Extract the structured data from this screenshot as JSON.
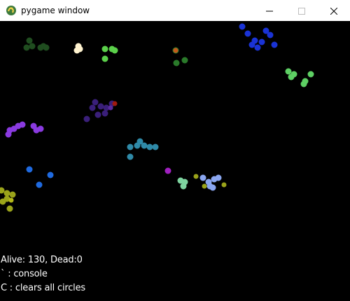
{
  "window": {
    "title": "pygame window",
    "icon": "pygame-snake-icon",
    "controls": [
      "minimize-icon",
      "maximize-icon",
      "close-icon"
    ]
  },
  "hud": {
    "status": "Alive: 130, Dead:0",
    "console_hint": "` : console",
    "clear_hint": "C : clears all circles"
  },
  "game": {
    "background": "#000000",
    "clusters": [
      {
        "name": "dark-green-cluster",
        "color": "#1f4d1f"
      },
      {
        "name": "cream-cluster",
        "color": "#fff3cf"
      },
      {
        "name": "lime-cluster",
        "color": "#5bd04a"
      },
      {
        "name": "orange-green-cluster",
        "color": "#2a7a2a"
      },
      {
        "name": "blue-cluster",
        "color": "#1a33d6"
      },
      {
        "name": "light-green-cluster",
        "color": "#5ed064"
      },
      {
        "name": "indigo-cluster",
        "color": "#3a1f7a"
      },
      {
        "name": "purple-cluster",
        "color": "#8a3ae0"
      },
      {
        "name": "teal-cluster",
        "color": "#2f8aa8"
      },
      {
        "name": "magenta-dot",
        "color": "#a020c0"
      },
      {
        "name": "azure-cluster",
        "color": "#1f6ae0"
      },
      {
        "name": "mint-cluster",
        "color": "#7ed4a0"
      },
      {
        "name": "periwinkle-cluster",
        "color": "#8aa6f0"
      },
      {
        "name": "olive-cluster",
        "color": "#9aa31a"
      }
    ]
  }
}
